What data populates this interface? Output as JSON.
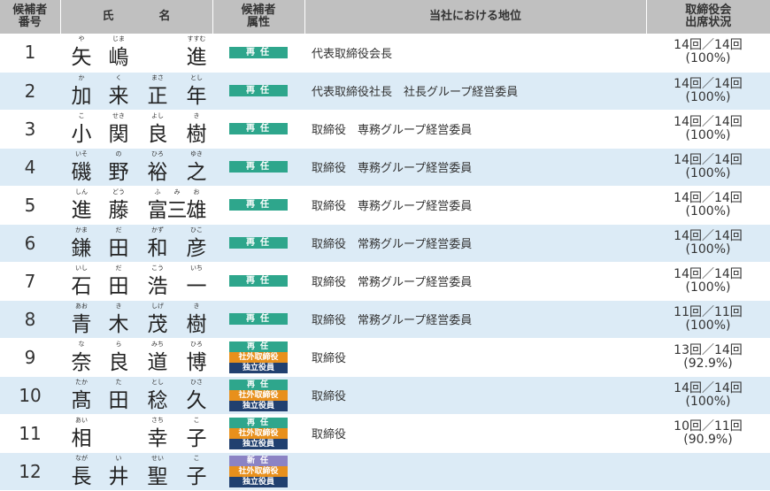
{
  "header": {
    "number": "候補者\n番号",
    "name_left": "氏",
    "name_right": "名",
    "attribute": "候補者\n属性",
    "position": "当社における地位",
    "attendance": "取締役会\n出席状況"
  },
  "colors": {
    "header_bg": "#c0c0c0",
    "row_alt_bg": "#dcebf6",
    "reappoint": "#2ea68c",
    "outside_director": "#e8901c",
    "independent": "#21406f",
    "new": "#8b83c4"
  },
  "rows": [
    {
      "num": "1",
      "chars": [
        "矢",
        "嶋",
        "",
        "進"
      ],
      "ruby": [
        "や",
        "じま",
        "",
        "すすむ"
      ],
      "badges": [
        {
          "text": "再任",
          "type": "reappoint"
        }
      ],
      "position": "代表取締役会長",
      "att1": "14回／14回",
      "att2": "(100%)"
    },
    {
      "num": "2",
      "chars": [
        "加",
        "来",
        "正",
        "年"
      ],
      "ruby": [
        "か",
        "く",
        "まさ",
        "とし"
      ],
      "badges": [
        {
          "text": "再任",
          "type": "reappoint"
        }
      ],
      "position": "代表取締役社長　社長グループ経営委員",
      "att1": "14回／14回",
      "att2": "(100%)"
    },
    {
      "num": "3",
      "chars": [
        "小",
        "関",
        "良",
        "樹"
      ],
      "ruby": [
        "こ",
        "せき",
        "よし",
        "き"
      ],
      "badges": [
        {
          "text": "再任",
          "type": "reappoint"
        }
      ],
      "position": "取締役　専務グループ経営委員",
      "att1": "14回／14回",
      "att2": "(100%)"
    },
    {
      "num": "4",
      "chars": [
        "磯",
        "野",
        "裕",
        "之"
      ],
      "ruby": [
        "いそ",
        "の",
        "ひろ",
        "ゆき"
      ],
      "badges": [
        {
          "text": "再任",
          "type": "reappoint"
        }
      ],
      "position": "取締役　専務グループ経営委員",
      "att1": "14回／14回",
      "att2": "(100%)"
    },
    {
      "num": "5",
      "chars": [
        "進",
        "藤",
        "富",
        "三",
        "雄"
      ],
      "ruby": [
        "しん",
        "どう",
        "ふ",
        "み",
        "お"
      ],
      "badges": [
        {
          "text": "再任",
          "type": "reappoint"
        }
      ],
      "position": "取締役　専務グループ経営委員",
      "att1": "14回／14回",
      "att2": "(100%)"
    },
    {
      "num": "6",
      "chars": [
        "鎌",
        "田",
        "和",
        "彦"
      ],
      "ruby": [
        "かま",
        "だ",
        "かず",
        "ひこ"
      ],
      "badges": [
        {
          "text": "再任",
          "type": "reappoint"
        }
      ],
      "position": "取締役　常務グループ経営委員",
      "att1": "14回／14回",
      "att2": "(100%)"
    },
    {
      "num": "7",
      "chars": [
        "石",
        "田",
        "浩",
        "一"
      ],
      "ruby": [
        "いし",
        "だ",
        "こう",
        "いち"
      ],
      "badges": [
        {
          "text": "再任",
          "type": "reappoint"
        }
      ],
      "position": "取締役　常務グループ経営委員",
      "att1": "14回／14回",
      "att2": "(100%)"
    },
    {
      "num": "8",
      "chars": [
        "青",
        "木",
        "茂",
        "樹"
      ],
      "ruby": [
        "あお",
        "き",
        "しげ",
        "き"
      ],
      "badges": [
        {
          "text": "再任",
          "type": "reappoint"
        }
      ],
      "position": "取締役　常務グループ経営委員",
      "att1": "11回／11回",
      "att2": "(100%)"
    },
    {
      "num": "9",
      "chars": [
        "奈",
        "良",
        "道",
        "博"
      ],
      "ruby": [
        "な",
        "ら",
        "みち",
        "ひろ"
      ],
      "badges": [
        {
          "text": "再任",
          "type": "reappoint"
        },
        {
          "text": "社外取締役",
          "type": "outside"
        },
        {
          "text": "独立役員",
          "type": "independent"
        }
      ],
      "position": "取締役",
      "att1": "13回／14回",
      "att2": "(92.9%)"
    },
    {
      "num": "10",
      "chars": [
        "髙",
        "田",
        "稔",
        "久"
      ],
      "ruby": [
        "たか",
        "た",
        "とし",
        "ひさ"
      ],
      "badges": [
        {
          "text": "再任",
          "type": "reappoint"
        },
        {
          "text": "社外取締役",
          "type": "outside"
        },
        {
          "text": "独立役員",
          "type": "independent"
        }
      ],
      "position": "取締役",
      "att1": "14回／14回",
      "att2": "(100%)"
    },
    {
      "num": "11",
      "chars": [
        "相",
        "",
        "幸",
        "子"
      ],
      "ruby": [
        "あい",
        "",
        "さち",
        "こ"
      ],
      "badges": [
        {
          "text": "再任",
          "type": "reappoint"
        },
        {
          "text": "社外取締役",
          "type": "outside"
        },
        {
          "text": "独立役員",
          "type": "independent"
        }
      ],
      "position": "取締役",
      "att1": "10回／11回",
      "att2": "(90.9%)"
    },
    {
      "num": "12",
      "chars": [
        "長",
        "井",
        "聖",
        "子"
      ],
      "ruby": [
        "なが",
        "い",
        "せい",
        "こ"
      ],
      "badges": [
        {
          "text": "新任",
          "type": "new"
        },
        {
          "text": "社外取締役",
          "type": "outside"
        },
        {
          "text": "独立役員",
          "type": "independent"
        }
      ],
      "position": "",
      "att1": "",
      "att2": ""
    }
  ]
}
